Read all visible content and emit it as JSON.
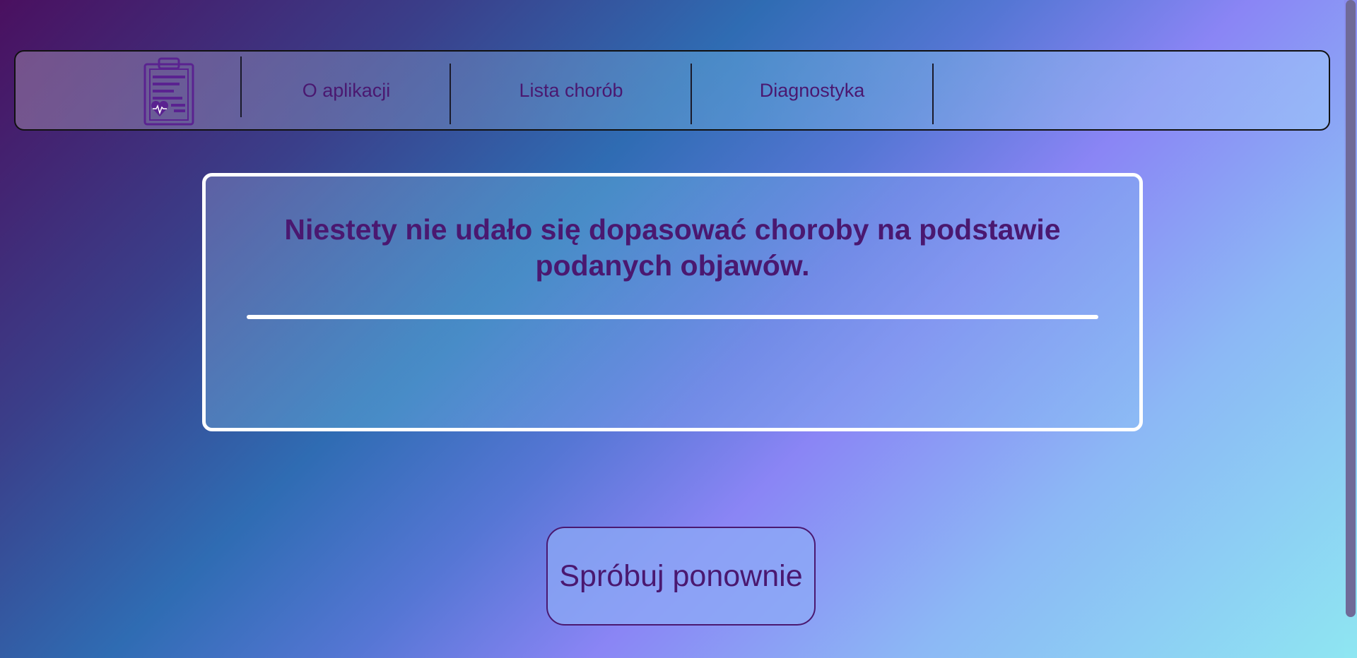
{
  "nav": {
    "logo_icon": "clipboard-heart-icon",
    "links": [
      "O aplikacji",
      "Lista chorób",
      "Diagnostyka"
    ]
  },
  "result": {
    "message": "Niestety nie udało się dopasować choroby na podstawie podanych objawów."
  },
  "actions": {
    "retry_label": "Spróbuj ponownie"
  },
  "colors": {
    "accent": "#4a1870",
    "card_border": "#ffffff"
  }
}
